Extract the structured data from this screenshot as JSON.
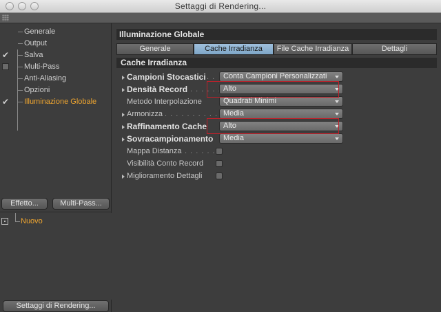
{
  "window": {
    "title": "Settaggi di Rendering..."
  },
  "sidebar": {
    "items": [
      {
        "label": "Generale",
        "check": ""
      },
      {
        "label": "Output",
        "check": ""
      },
      {
        "label": "Salva",
        "check": "tick"
      },
      {
        "label": "Multi-Pass",
        "check": "box"
      },
      {
        "label": "Anti-Aliasing",
        "check": ""
      },
      {
        "label": "Opzioni",
        "check": ""
      },
      {
        "label": "Illuminazione Globale",
        "check": "tick",
        "active": true
      }
    ],
    "effect_button": "Effetto...",
    "multipass_button": "Multi-Pass...",
    "effect_item": "Nuovo",
    "render_settings_button": "Settaggi di Rendering..."
  },
  "panel": {
    "title": "Illuminazione Globale",
    "tabs": [
      "Generale",
      "Cache Irradianza",
      "File Cache Irradianza",
      "Dettagli"
    ],
    "active_tab": 1,
    "section": "Cache Irradianza",
    "props": [
      {
        "name": "Campioni Stocastici",
        "dots": ". .",
        "bold": true,
        "expand": true,
        "value": "Conta Campioni Personalizzati"
      },
      {
        "name": "Densità Record",
        "dots": ". . . . . .",
        "bold": true,
        "expand": true,
        "value": "Alto",
        "highlight": true
      },
      {
        "name": "Metodo Interpolazione",
        "dots": "",
        "bold": false,
        "expand": false,
        "value": "Quadrati Minimi"
      },
      {
        "name": "Armonizza",
        "dots": ". . . . . . . . . .",
        "bold": false,
        "expand": true,
        "value": "Media"
      },
      {
        "name": "Raffinamento Cache",
        "dots": "",
        "bold": true,
        "expand": true,
        "value": "Alto",
        "highlight": true
      },
      {
        "name": "Sovracampionamento",
        "dots": "",
        "bold": true,
        "expand": true,
        "value": "Media"
      },
      {
        "name": "Mappa Distanza",
        "dots": ". . . . . . .",
        "bold": false,
        "expand": false,
        "checkbox": true
      },
      {
        "name": "Visibilità Conto Record",
        "dots": "",
        "bold": false,
        "expand": false,
        "checkbox": true
      },
      {
        "name": "Miglioramento Dettagli",
        "dots": "",
        "bold": false,
        "expand": true,
        "checkbox": true
      }
    ]
  },
  "colors": {
    "accent": "#f0a630",
    "active_tab": "#8fb4d4",
    "highlight_box": "#c0202a"
  }
}
